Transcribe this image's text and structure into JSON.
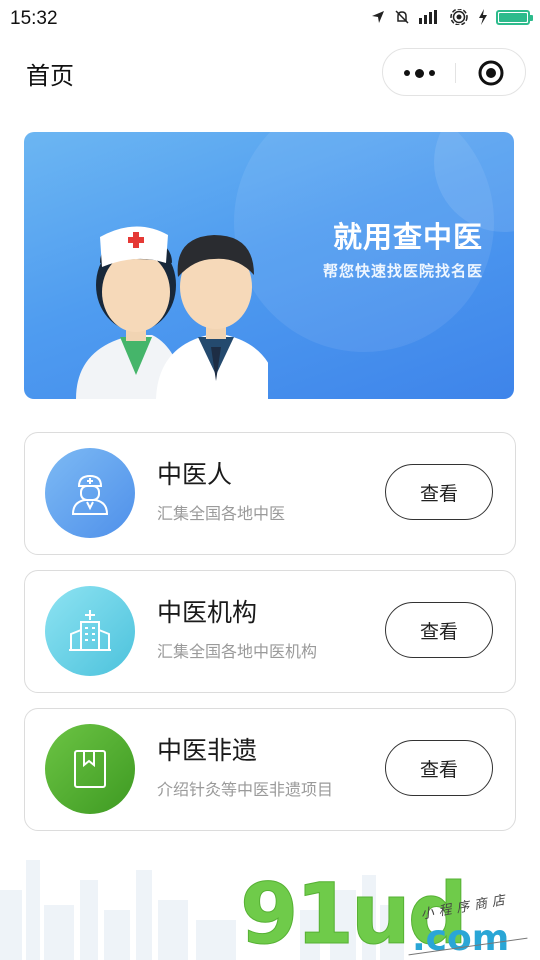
{
  "status_bar": {
    "time": "15:32",
    "icons": [
      "location-icon",
      "mute-bell-icon",
      "signal-icon",
      "wifi-icon",
      "charging-icon",
      "battery-icon"
    ],
    "battery_color": "#2dbb8c"
  },
  "nav": {
    "title": "首页",
    "capsule_icons": [
      "more-dots-icon",
      "close-target-icon"
    ]
  },
  "banner": {
    "title": "就用查中医",
    "subtitle": "帮您快速找医院找名医",
    "bg_colors": [
      "#6cb6f2",
      "#3e84ea"
    ]
  },
  "cards": [
    {
      "title": "中医人",
      "desc": "汇集全国各地中医",
      "button": "查看",
      "icon": "doctor-icon",
      "color": "#5fa4ee"
    },
    {
      "title": "中医机构",
      "desc": "汇集全国各地中医机构",
      "button": "查看",
      "icon": "hospital-icon",
      "color": "#63cfe6"
    },
    {
      "title": "中医非遗",
      "desc": "介绍针灸等中医非遗项目",
      "button": "查看",
      "icon": "heritage-book-icon",
      "color": "#58b532"
    }
  ],
  "watermark": {
    "brand": "91ud",
    "tld": ".com",
    "tagline": "小程序商店"
  }
}
